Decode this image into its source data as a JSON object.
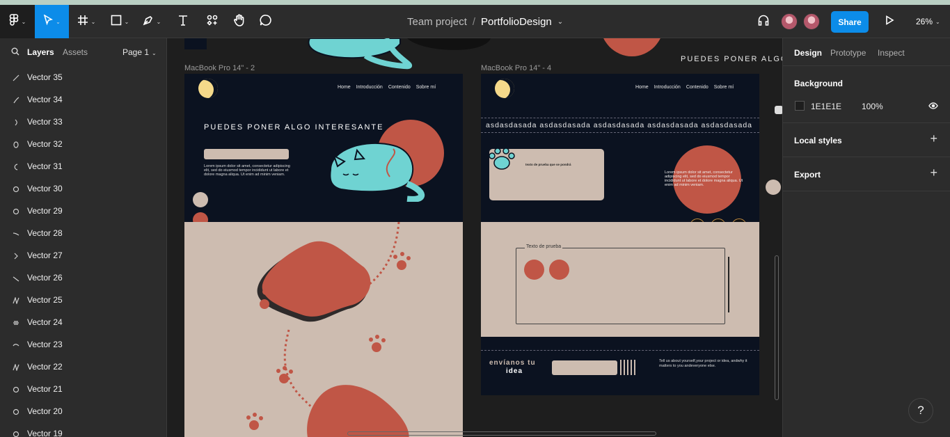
{
  "toolbar": {
    "breadcrumb_team": "Team project",
    "breadcrumb_sep": "/",
    "file_name": "PortfolioDesign",
    "share_label": "Share",
    "zoom": "26%"
  },
  "layers_panel": {
    "tab_layers": "Layers",
    "tab_assets": "Assets",
    "page_label": "Page 1",
    "items": [
      {
        "label": "Vector 35"
      },
      {
        "label": "Vector 34"
      },
      {
        "label": "Vector 33"
      },
      {
        "label": "Vector 32"
      },
      {
        "label": "Vector 31"
      },
      {
        "label": "Vector 30"
      },
      {
        "label": "Vector 29"
      },
      {
        "label": "Vector 28"
      },
      {
        "label": "Vector 27"
      },
      {
        "label": "Vector 26"
      },
      {
        "label": "Vector 25"
      },
      {
        "label": "Vector 24"
      },
      {
        "label": "Vector 23"
      },
      {
        "label": "Vector 22"
      },
      {
        "label": "Vector 21"
      },
      {
        "label": "Vector 20"
      },
      {
        "label": "Vector 19"
      }
    ]
  },
  "canvas": {
    "frame_a": {
      "name": "MacBook Pro 14\" - 2",
      "nav": [
        "Home",
        "Introducción",
        "Contenido",
        "Sobre mí"
      ],
      "headline": "PUEDES PONER ALGO INTERESANTE",
      "body": "Lorem ipsum dolor sit amet, consectetur adipiscing elit, sed do eiusmod tempor incididunt ut labore et dolore magna aliqua. Ut enim ad minim veniam."
    },
    "frame_b": {
      "name": "MacBook Pro 14\" - 4",
      "nav": [
        "Home",
        "Introducción",
        "Contenido",
        "Sobre mí"
      ],
      "marquee": "asdasdasada asdasdasada asdasdasada asdasdasada asdasdasada",
      "card_title": "texto de prueba que se pondrá",
      "body": "Lorem ipsum dolor sit amet, consectetur adipiscing elit, sed do eiusmod tempor incididunt ut labore et dolore magna aliqua. Ut enim ad minim veniam.",
      "box_label": "Texto de prueba",
      "cta_line1": "envíanos tu",
      "cta_line2": "idea",
      "cta_text": "Tell us about yourself,your project or idea, andwhy it matters to you andeveryone else."
    },
    "top_cut_text": "PUEDES PONER ALGO I"
  },
  "design_panel": {
    "tab_design": "Design",
    "tab_prototype": "Prototype",
    "tab_inspect": "Inspect",
    "background_title": "Background",
    "bg_hex": "1E1E1E",
    "bg_opacity": "100%",
    "local_styles": "Local styles",
    "export": "Export"
  },
  "help_label": "?",
  "colors": {
    "navy": "#0b1220",
    "beige": "#cdbcb0",
    "coral": "#c05646",
    "cyan": "#6fd3d2",
    "accent_blue": "#0c8ce9"
  }
}
